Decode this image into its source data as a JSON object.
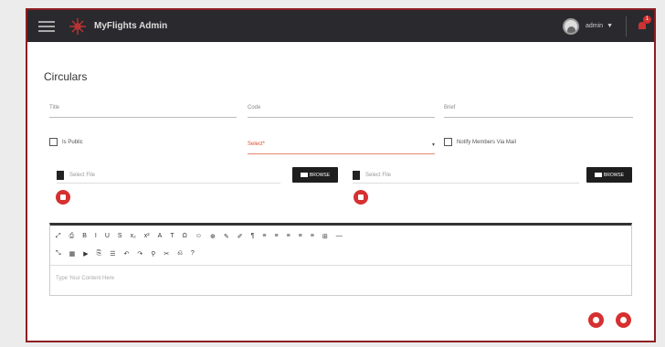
{
  "app": {
    "title": "MyFlights Admin"
  },
  "header": {
    "user": "admin",
    "notification_count": "1"
  },
  "page": {
    "title": "Circulars"
  },
  "form": {
    "title_placeholder": "Title",
    "code_placeholder": "Code",
    "brief_placeholder": "Brief",
    "is_public_label": "Is Public",
    "select_placeholder": "Select*",
    "notify_label": "Notify Members Via Mail",
    "file1_placeholder": "Select File",
    "file2_placeholder": "Select File",
    "browse_label": "BROWSE"
  },
  "editor": {
    "toolbar_row1": [
      "⤢",
      "⎙",
      "B",
      "I",
      "U",
      "S",
      "x₂",
      "x²",
      "A",
      "T",
      "Ω",
      "☺",
      "⊕",
      "✎",
      "✐",
      "¶",
      "≡",
      "≡",
      "≡",
      "≡",
      "≡",
      "⊞",
      "—"
    ],
    "toolbar_row2": [
      "⤡",
      "▦",
      "▶",
      "⎘",
      "☰",
      "↶",
      "↷",
      "⚲",
      "✂",
      "⎌",
      "?"
    ],
    "placeholder": "Type Your Content Here"
  },
  "colors": {
    "accent": "#d63030",
    "topbar": "#2a2a2e",
    "frame": "#8c1e22"
  },
  "icons": {
    "menu": "hamburger-icon",
    "logo": "app-logo-icon",
    "bell": "bell-icon",
    "file": "file-icon",
    "upload": "upload-icon",
    "save": "save-icon",
    "add": "add-icon"
  }
}
